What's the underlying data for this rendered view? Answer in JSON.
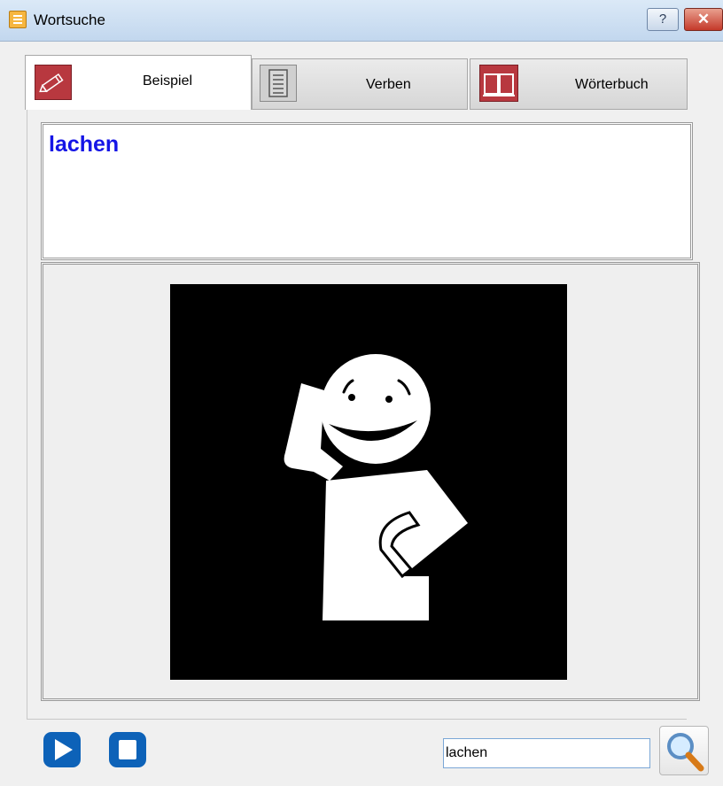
{
  "window": {
    "title": "Wortsuche",
    "help_label": "?",
    "close_label": "✕"
  },
  "tabs": [
    {
      "label": "Beispiel",
      "icon": "pencil-icon",
      "active": true
    },
    {
      "label": "Verben",
      "icon": "document-icon",
      "active": false
    },
    {
      "label": "Wörterbuch",
      "icon": "book-icon",
      "active": false
    }
  ],
  "word": {
    "text": "lachen",
    "color": "#1515e6"
  },
  "pictogram": {
    "icon": "laughing-person-pictogram",
    "background": "#000000",
    "foreground": "#ffffff"
  },
  "controls": {
    "play_icon": "play-icon",
    "stop_icon": "stop-icon",
    "accent": "#0d62b8"
  },
  "search": {
    "value": "lachen",
    "icon": "magnifier-icon"
  }
}
